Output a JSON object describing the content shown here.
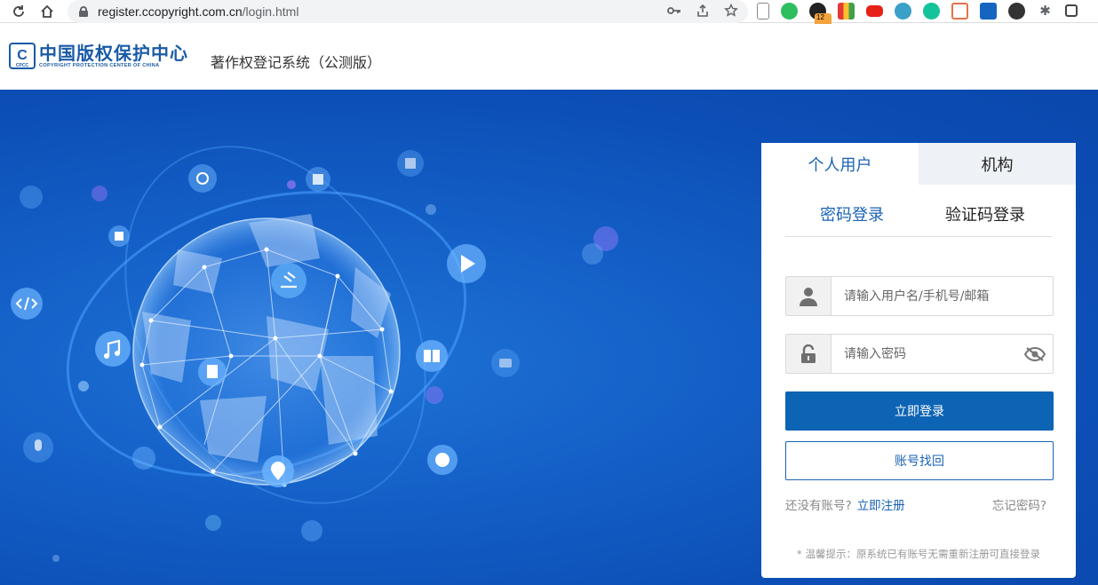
{
  "browser": {
    "url_host": "register.ccopyright.com.cn",
    "url_path": "/login.html",
    "extension_badge": "12"
  },
  "header": {
    "logo_cn": "中国版权保护中心",
    "logo_en": "COPYRIGHT PROTECTION CENTER OF CHINA",
    "logo_mark": "C",
    "logo_mark_small": "CPCC",
    "system_title": "著作权登记系统（公测版）"
  },
  "login": {
    "tabs": [
      {
        "label": "个人用户",
        "active": true
      },
      {
        "label": "机构",
        "active": false
      }
    ],
    "subtabs": [
      {
        "label": "密码登录",
        "active": true
      },
      {
        "label": "验证码登录",
        "active": false
      }
    ],
    "username_placeholder": "请输入用户名/手机号/邮箱",
    "password_placeholder": "请输入密码",
    "login_button": "立即登录",
    "recover_button": "账号找回",
    "no_account_text": "还没有账号?",
    "register_link": "立即注册",
    "forgot_link": "忘记密码?",
    "tip": "* 温馨提示：原系统已有账号无需重新注册可直接登录"
  },
  "colors": {
    "primary": "#0d64b4",
    "accent_text": "#1a63b4",
    "banner": "#1460c8"
  }
}
